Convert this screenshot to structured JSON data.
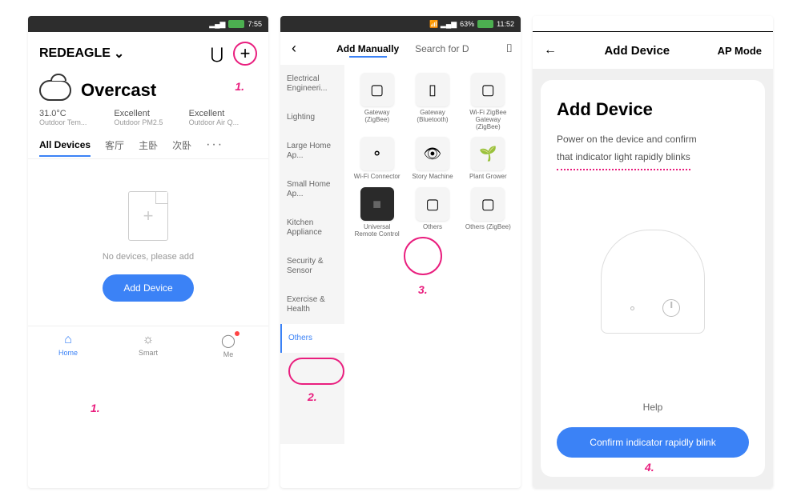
{
  "screen1": {
    "status_time": "7:55",
    "home_name": "REDEAGLE",
    "weather_condition": "Overcast",
    "cols": [
      {
        "val": "31.0°C",
        "lab": "Outdoor Tem..."
      },
      {
        "val": "Excellent",
        "lab": "Outdoor PM2.5"
      },
      {
        "val": "Excellent",
        "lab": "Outdoor Air Q..."
      }
    ],
    "tabs": [
      "All Devices",
      "客厅",
      "主卧",
      "次卧"
    ],
    "empty_text": "No devices, please add",
    "add_button": "Add Device",
    "nav": {
      "home": "Home",
      "smart": "Smart",
      "me": "Me"
    }
  },
  "screen2": {
    "status": "63%",
    "status_time": "11:52",
    "tab_manual": "Add Manually",
    "tab_search": "Search for D",
    "sidebar": [
      "Electrical Engineeri...",
      "Lighting",
      "Large Home Ap...",
      "Small Home Ap...",
      "Kitchen Appliance",
      "Security & Sensor",
      "Exercise & Health",
      "Others"
    ],
    "devices": [
      "Gateway (ZigBee)",
      "Gateway (Bluetooth)",
      "Wi-Fi ZigBee Gateway (ZigBee)",
      "Wi-Fi Connector",
      "Story Machine",
      "Plant Grower",
      "Universal Remote Control",
      "Others",
      "Others (ZigBee)"
    ]
  },
  "screen3": {
    "header_title": "Add Device",
    "ap_mode": "AP Mode",
    "title": "Add Device",
    "line1": "Power on the device and confirm",
    "line2": "that indicator light rapidly blinks",
    "help": "Help",
    "confirm": "Confirm indicator rapidly blink"
  },
  "anno": {
    "n1": "1.",
    "n2": "2.",
    "n3": "3.",
    "n4": "4."
  }
}
